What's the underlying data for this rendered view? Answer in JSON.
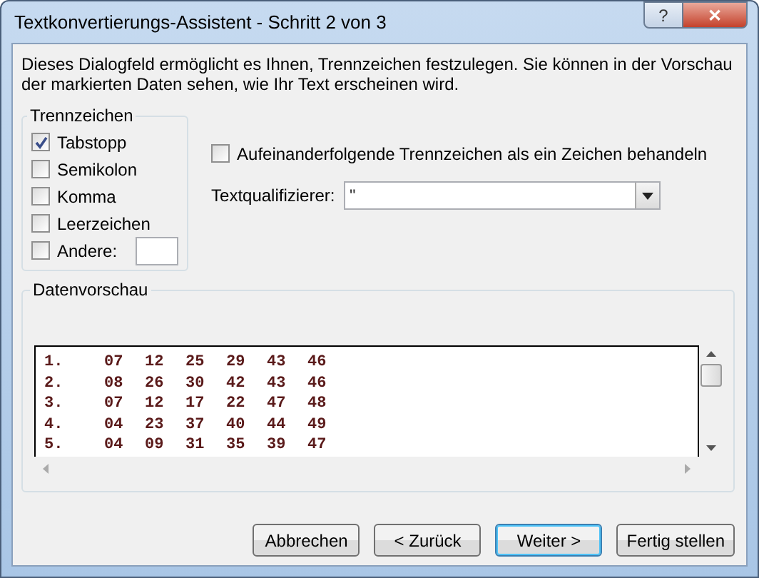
{
  "window": {
    "title": "Textkonvertierungs-Assistent - Schritt 2 von 3",
    "help_button": "?",
    "close_button": "✕"
  },
  "intro": "Dieses Dialogfeld ermöglicht es Ihnen, Trennzeichen festzulegen. Sie können in der Vorschau der markierten Daten sehen, wie Ihr Text erscheinen wird.",
  "delimiters": {
    "title": "Trennzeichen",
    "items": [
      {
        "label": "Tabstopp",
        "checked": true
      },
      {
        "label": "Semikolon",
        "checked": false
      },
      {
        "label": "Komma",
        "checked": false
      },
      {
        "label": "Leerzeichen",
        "checked": false
      },
      {
        "label": "Andere:",
        "checked": false,
        "kind": "other"
      }
    ]
  },
  "consecutive": {
    "label": "Aufeinanderfolgende Trennzeichen als ein Zeichen behandeln",
    "checked": false
  },
  "qualifier": {
    "label": "Textqualifizierer:",
    "value": "\""
  },
  "preview": {
    "title": "Datenvorschau",
    "rows": [
      [
        "1.",
        "07",
        "12",
        "25",
        "29",
        "43",
        "46"
      ],
      [
        "2.",
        "08",
        "26",
        "30",
        "42",
        "43",
        "46"
      ],
      [
        "3.",
        "07",
        "12",
        "17",
        "22",
        "47",
        "48"
      ],
      [
        "4.",
        "04",
        "23",
        "37",
        "40",
        "44",
        "49"
      ],
      [
        "5.",
        "04",
        "09",
        "31",
        "35",
        "39",
        "47"
      ]
    ]
  },
  "buttons": [
    {
      "label": "Abbrechen",
      "default": false
    },
    {
      "label": "< Zurück",
      "default": false
    },
    {
      "label": "Weiter >",
      "default": true
    },
    {
      "label": "Fertig stellen",
      "default": false
    }
  ]
}
